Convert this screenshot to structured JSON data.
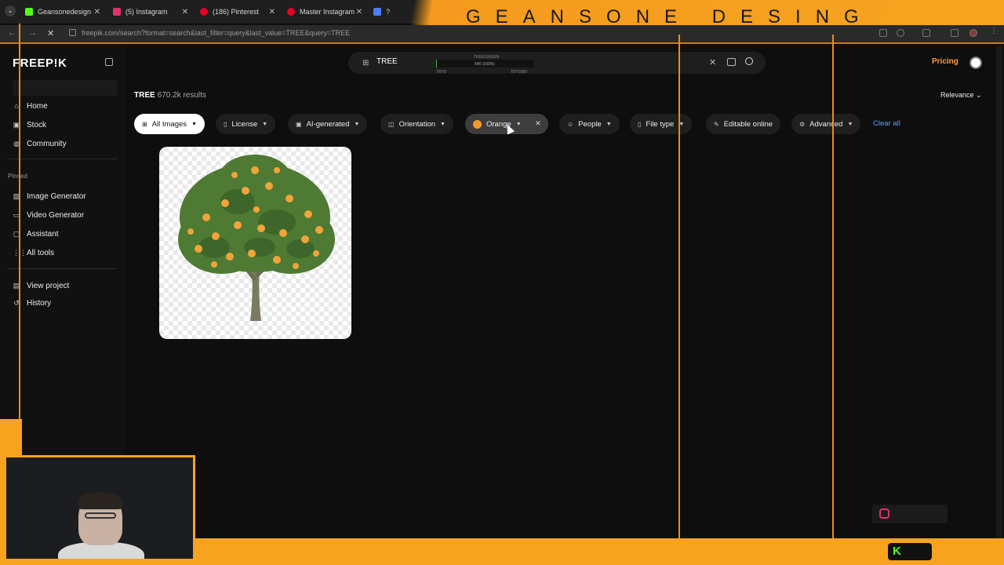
{
  "browser": {
    "tabs": [
      {
        "title": "Geansonedesign",
        "favicon_color": "#53fc18"
      },
      {
        "title": "(5) Instagram",
        "favicon_color": "#e1306c"
      },
      {
        "title": "(186) Pinterest",
        "favicon_color": "#e60023"
      },
      {
        "title": "Master Instagram",
        "favicon_color": "#e60023"
      },
      {
        "title": "?",
        "favicon_color": "#4a7dff"
      }
    ],
    "url": "freepik.com/search?format=search&last_filter=query&last_value=TREE&query=TREE"
  },
  "overlay": {
    "brand_text": "GEANSONE DESING",
    "accent_color": "#f7a31f",
    "kick_icon": "K"
  },
  "sidebar": {
    "logo": "FREEP!K",
    "primary": [
      {
        "label": "Home",
        "icon": "home-icon",
        "glyph": "⌂"
      },
      {
        "label": "Stock",
        "icon": "stock-icon",
        "glyph": "▣"
      },
      {
        "label": "Community",
        "icon": "community-icon",
        "glyph": "◍"
      }
    ],
    "pinned_label": "Pinned",
    "pinned": [
      {
        "label": "Image Generator",
        "icon": "image-generator-icon",
        "glyph": "▨"
      },
      {
        "label": "Video Generator",
        "icon": "video-generator-icon",
        "glyph": "▭"
      },
      {
        "label": "Assistant",
        "icon": "assistant-icon",
        "glyph": "▢"
      },
      {
        "label": "All tools",
        "icon": "grid-icon",
        "glyph": "⋮⋮"
      }
    ],
    "bottom": [
      {
        "label": "View project",
        "icon": "project-icon",
        "glyph": "▤"
      },
      {
        "label": "History",
        "icon": "history-icon",
        "glyph": "↺"
      }
    ]
  },
  "search": {
    "value": "TREE",
    "overlay_top": "TREE/GREEN",
    "overlay_mid": "546 (100%)",
    "overlay_left": "TRY0",
    "overlay_right": "TRY3000"
  },
  "header": {
    "pricing": "Pricing"
  },
  "results": {
    "query": "TREE",
    "count": "670.2k results",
    "sort": "Relevance"
  },
  "filters": [
    {
      "label": "All Images",
      "icon": "grid-icon",
      "glyph": "⊞"
    },
    {
      "label": "License",
      "icon": "license-icon",
      "glyph": "▯"
    },
    {
      "label": "AI-generated",
      "icon": "ai-icon",
      "glyph": "▣"
    },
    {
      "label": "Orientation",
      "icon": "orientation-icon",
      "glyph": "◫"
    },
    {
      "label": "Orange",
      "icon": "color-dot-icon",
      "color": "#f39a2c"
    },
    {
      "label": "People",
      "icon": "people-icon",
      "glyph": "☺"
    },
    {
      "label": "File type",
      "icon": "file-icon",
      "glyph": "▯"
    },
    {
      "label": "Editable online",
      "icon": "edit-icon",
      "glyph": "✎"
    },
    {
      "label": "Advanced",
      "icon": "settings-icon",
      "glyph": "⚙"
    }
  ],
  "clear_all": "Clear all",
  "result_items": [
    {
      "alt": "Orange tree",
      "colors": {
        "leaf": "#4e7a33",
        "fruit": "#f0a43a",
        "trunk": "#7b7a60"
      }
    }
  ]
}
